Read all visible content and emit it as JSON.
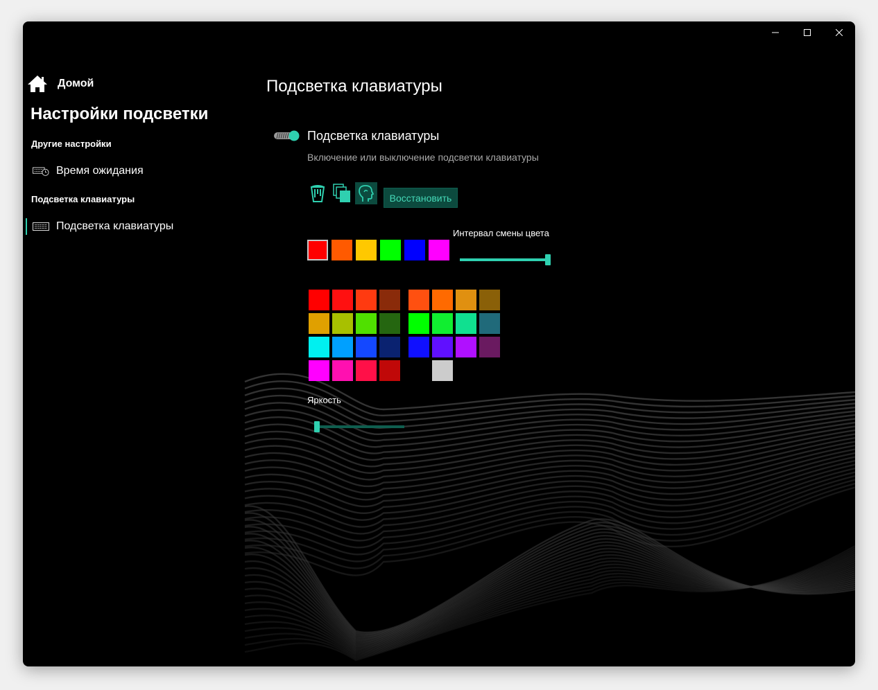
{
  "window": {
    "controls": {
      "minimize_icon": "minimize-icon",
      "maximize_icon": "maximize-icon",
      "close_icon": "close-icon"
    }
  },
  "sidebar": {
    "home_label": "Домой",
    "app_title": "Настройки подсветки",
    "sections": [
      {
        "title": "Другие настройки",
        "items": [
          {
            "label": "Время ожидания",
            "icon": "keyboard-clock-icon"
          }
        ]
      },
      {
        "title": "Подсветка клавиатуры",
        "items": [
          {
            "label": "Подсветка клавиатуры",
            "icon": "keyboard-icon",
            "selected": true
          }
        ]
      }
    ]
  },
  "main": {
    "title": "Подсветка клавиатуры",
    "backlight_toggle": {
      "on": true,
      "label": "Подсветка клавиатуры",
      "description": "Включение или выключение подсветки клавиатуры"
    },
    "mode_icons": [
      "paint-bucket-icon",
      "color-layers-icon",
      "head-profile-icon"
    ],
    "restore_label": "Восстановить",
    "quick_colors": [
      "#ff0000",
      "#ff5a00",
      "#ffc800",
      "#00ff00",
      "#0000ff",
      "#ff00ff"
    ],
    "selected_quick_color": 0,
    "interval": {
      "label": "Интервал смены цвета",
      "value": 1.0
    },
    "palette_left": [
      [
        "#ff0000",
        "#ff1010",
        "#ff3a10",
        "#8a2b0a"
      ],
      [
        "#e0a000",
        "#a8c000",
        "#50e000",
        "#256610"
      ],
      [
        "#00f0f0",
        "#00a0ff",
        "#1448ff",
        "#0a2270"
      ],
      [
        "#ff00ff",
        "#ff10b0",
        "#ff1048",
        "#c00808"
      ]
    ],
    "palette_right": [
      [
        "#ff5010",
        "#ff6a00",
        "#e09010",
        "#8a6008"
      ],
      [
        "#00ff00",
        "#10ee30",
        "#10e090",
        "#206a7a"
      ],
      [
        "#1010ff",
        "#6010ff",
        "#b010ff",
        "#6a1a60"
      ],
      [
        "",
        "#cccccc",
        "",
        ""
      ]
    ],
    "brightness": {
      "label": "Яркость",
      "value": 0.0
    },
    "accent_color": "#2fd0b0"
  }
}
